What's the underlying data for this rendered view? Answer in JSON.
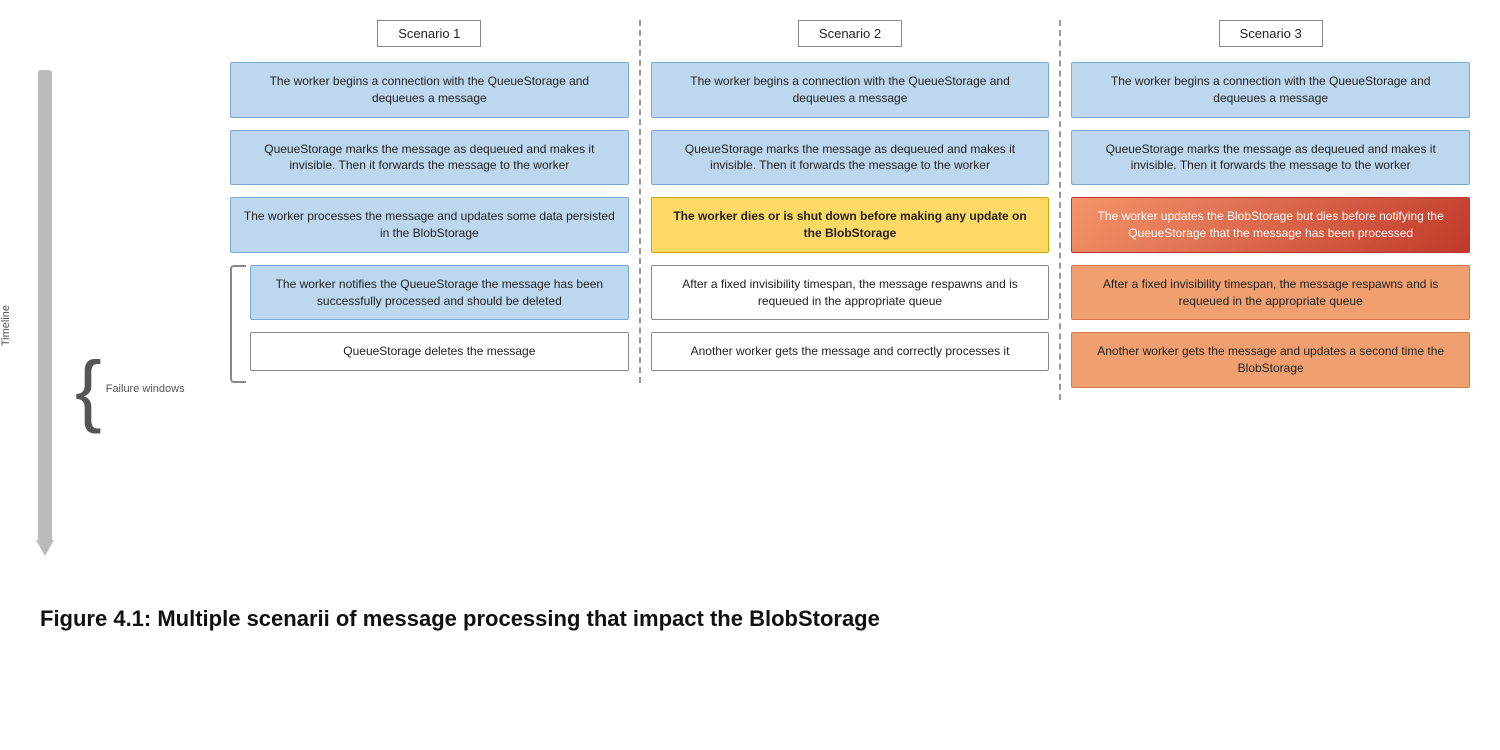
{
  "diagram": {
    "title": "Figure 4.1: Multiple scenarii of message processing that impact the BlobStorage",
    "scenarios": [
      {
        "id": "scenario1",
        "title": "Scenario 1",
        "steps": [
          {
            "text": "The worker begins a connection with the QueueStorage and dequeues a message",
            "style": "blue-light"
          },
          {
            "text": "QueueStorage marks the message as dequeued and makes it invisible. Then it forwards the message to the worker",
            "style": "blue-light"
          },
          {
            "text": "The worker processes the message and updates some data persisted in the BlobStorage",
            "style": "blue-light"
          },
          {
            "text": "The worker notifies the QueueStorage the message has been successfully processed and should be deleted",
            "style": "blue-light"
          },
          {
            "text": "QueueStorage deletes the message",
            "style": "white-border"
          }
        ]
      },
      {
        "id": "scenario2",
        "title": "Scenario 2",
        "steps": [
          {
            "text": "The worker begins a connection with the QueueStorage and dequeues a message",
            "style": "blue-light"
          },
          {
            "text": "QueueStorage marks the message as dequeued and makes it invisible. Then it forwards the message to the worker",
            "style": "blue-light"
          },
          {
            "text": "The worker dies or is shut down before making any update on the BlobStorage",
            "style": "yellow"
          },
          {
            "text": "After a fixed invisibility timespan, the message respawns and is requeued in the appropriate queue",
            "style": "white-border"
          },
          {
            "text": "Another worker gets the message and correctly processes it",
            "style": "white-border"
          }
        ]
      },
      {
        "id": "scenario3",
        "title": "Scenario 3",
        "steps": [
          {
            "text": "The worker begins a connection with the QueueStorage and dequeues a message",
            "style": "blue-light"
          },
          {
            "text": "QueueStorage marks the message as dequeued and makes it invisible. Then it forwards the message to the worker",
            "style": "blue-light"
          },
          {
            "text": "The worker updates the BlobStorage but dies before notifying the QueueStorage that the message has been processed",
            "style": "orange-red"
          },
          {
            "text": "After a fixed invisibility timespan, the message respawns and is requeued in the appropriate queue",
            "style": "orange-light"
          },
          {
            "text": "Another worker gets the message and updates a second time the BlobStorage",
            "style": "orange-light"
          }
        ]
      }
    ],
    "timeline_label": "Timeline",
    "failure_label": "Failure\nwindows"
  }
}
